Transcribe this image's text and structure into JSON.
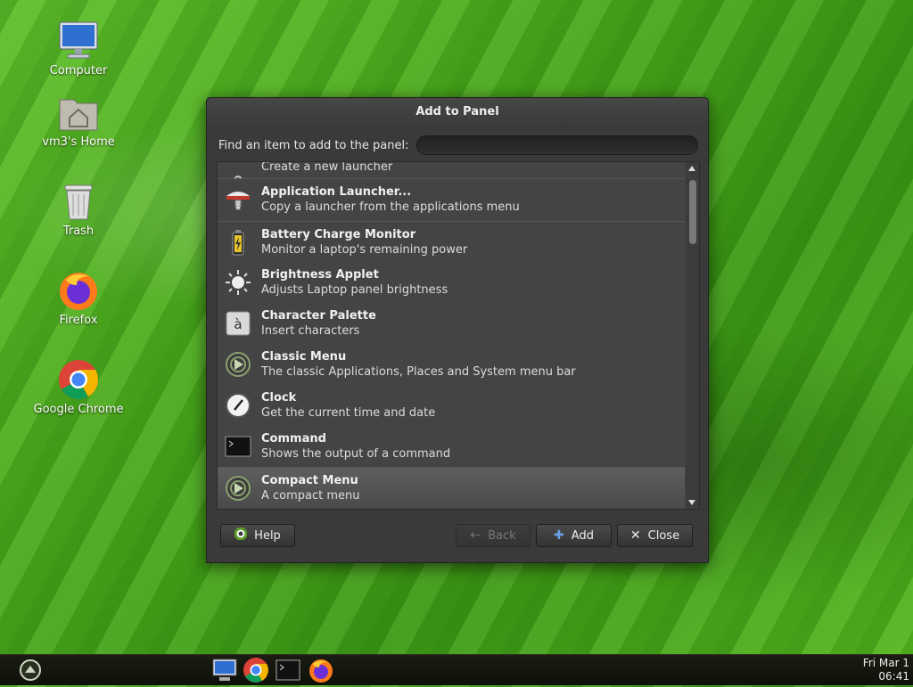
{
  "desktop": {
    "icons": [
      {
        "label": "Computer",
        "icon": "computer-icon"
      },
      {
        "label": "vm3's Home",
        "icon": "home-folder-icon"
      },
      {
        "label": "Trash",
        "icon": "trash-icon"
      },
      {
        "label": "Firefox",
        "icon": "firefox-icon"
      },
      {
        "label": "Google Chrome",
        "icon": "chrome-icon"
      }
    ]
  },
  "dialog": {
    "title": "Add to Panel",
    "find_label": "Find an item to add to the panel:",
    "find_value": "",
    "items": [
      {
        "name": "",
        "desc": "Create a new launcher",
        "icon": "launcher-icon"
      },
      {
        "name": "Application Launcher...",
        "desc": "Copy a launcher from the applications menu",
        "icon": "app-launcher-icon"
      },
      {
        "name": "Battery Charge Monitor",
        "desc": "Monitor a laptop's remaining power",
        "icon": "battery-icon"
      },
      {
        "name": "Brightness Applet",
        "desc": "Adjusts Laptop panel brightness",
        "icon": "brightness-icon"
      },
      {
        "name": "Character Palette",
        "desc": "Insert characters",
        "icon": "character-palette-icon"
      },
      {
        "name": "Classic Menu",
        "desc": "The classic Applications, Places and System menu bar",
        "icon": "classic-menu-icon"
      },
      {
        "name": "Clock",
        "desc": "Get the current time and date",
        "icon": "clock-icon"
      },
      {
        "name": "Command",
        "desc": "Shows the output of a command",
        "icon": "terminal-icon"
      },
      {
        "name": "Compact Menu",
        "desc": "A compact menu",
        "icon": "compact-menu-icon"
      }
    ],
    "buttons": {
      "help": "Help",
      "back": "Back",
      "add": "Add",
      "close": "Close"
    }
  },
  "taskbar": {
    "clock_date": "Fri Mar 1",
    "clock_time": "06:41"
  }
}
